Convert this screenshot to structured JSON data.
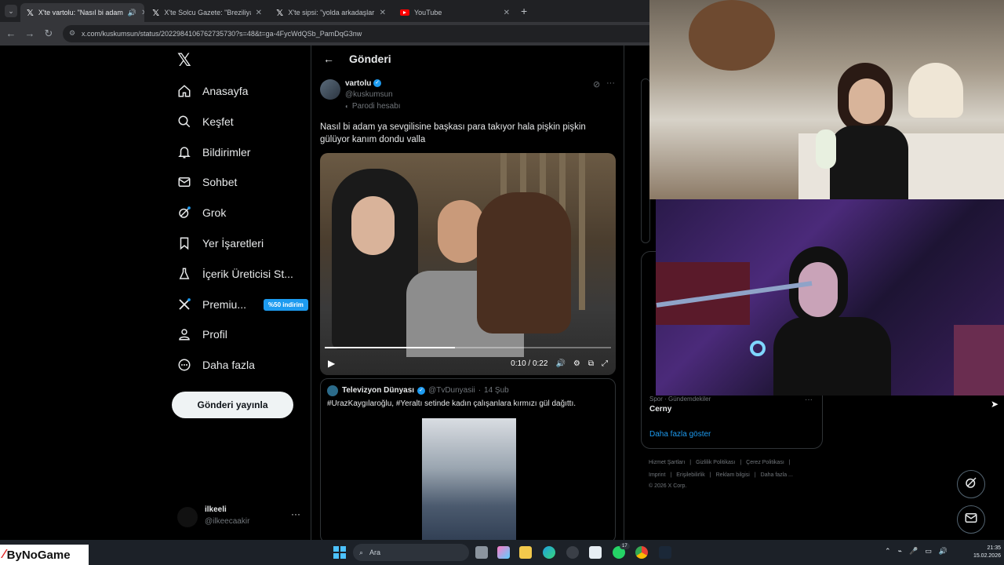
{
  "browser": {
    "tabs": [
      {
        "title": "X'te vartolu: \"Nasıl bi adam",
        "active": true
      },
      {
        "title": "X'te Solcu Gazete: \"Breziliya'da"
      },
      {
        "title": "X'te sipsi: \"yolda arkadaşlarınla"
      },
      {
        "title": "YouTube"
      }
    ],
    "url": "x.com/kuskumsun/status/2022984106762735730?s=48&t=ga-4FycWdQSb_PamDqG3nw"
  },
  "sidebar": {
    "items": [
      {
        "label": "Anasayfa"
      },
      {
        "label": "Keşfet"
      },
      {
        "label": "Bildirimler"
      },
      {
        "label": "Sohbet"
      },
      {
        "label": "Grok"
      },
      {
        "label": "Yer İşaretleri"
      },
      {
        "label": "İçerik Üreticisi St..."
      },
      {
        "label": "Premiu...",
        "badge": "%50 indirim"
      },
      {
        "label": "Profil"
      },
      {
        "label": "Daha fazla"
      }
    ],
    "post_button": "Gönderi yayınla",
    "account": {
      "name": "ilkeeli",
      "handle": "@ilkeecaakir"
    }
  },
  "main": {
    "header_title": "Gönderi",
    "tweet": {
      "name": "vartolu",
      "handle": "@kuskumsun",
      "parody": "Parodi hesabı",
      "text": "Nasıl bi adam ya sevgilisine başkası para takıyor hala pişkin pişkin gülüyor kanım dondu valla",
      "video": {
        "time": "0:10 / 0:22",
        "progress": 0.455
      }
    },
    "quote": {
      "name": "Televizyon Dünyası",
      "handle": "@TvDunyasii",
      "date": "14 Şub",
      "text": "#UrazKaygılaroğlu, #Yeraltı setinde kadın çalışanlara kırmızı gül dağıttı."
    }
  },
  "right": {
    "trend_category": "Spor · Gündemdekiler",
    "trend_name": "Cerny",
    "show_more": "Daha fazla göster",
    "footer_row1": [
      "Hizmet Şartları",
      "Gizlilik Politikası",
      "Çerez Politikası"
    ],
    "footer_row2": [
      "Imprint",
      "Erişilebilirlik",
      "Reklam bilgisi",
      "Daha fazla ..."
    ],
    "copyright": "© 2026 X Corp."
  },
  "taskbar": {
    "brand": "ByNoGame",
    "search_placeholder": "Ara",
    "time": "21:35",
    "date": "15.02.2026",
    "whatsapp_badge": "17"
  }
}
